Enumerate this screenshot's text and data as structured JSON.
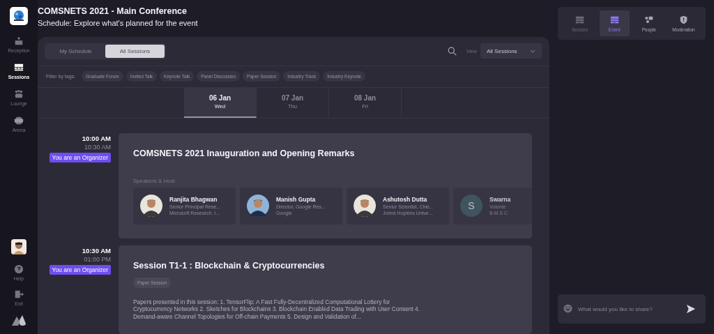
{
  "event": {
    "title": "COMSNETS 2021 - Main Conference",
    "subtitle": "Schedule: Explore what's planned for the event"
  },
  "sidebar": {
    "items": [
      {
        "label": "Reception",
        "selected": false
      },
      {
        "label": "Sessions",
        "selected": true
      },
      {
        "label": "Lounge",
        "selected": false
      },
      {
        "label": "Arena",
        "selected": false
      }
    ],
    "bottom_items": [
      "Help",
      "Exit"
    ]
  },
  "schedule_toggle": [
    {
      "label": "My Schedule",
      "selected": false
    },
    {
      "label": "All Sessions",
      "selected": true
    }
  ],
  "view": {
    "label": "View",
    "value": "All Sessions"
  },
  "filter": {
    "label": "Filter by tags:",
    "tags": [
      "Graduate Forum",
      "Invited Talk",
      "Keynote Talk",
      "Panel Discussion",
      "Paper Session",
      "Industry Track",
      "Industry Keynote"
    ]
  },
  "days": [
    {
      "date": "06 Jan",
      "weekday": "Wed",
      "selected": true
    },
    {
      "date": "07 Jan",
      "weekday": "Thu",
      "selected": false
    },
    {
      "date": "08 Jan",
      "weekday": "Fri",
      "selected": false
    }
  ],
  "sessions": [
    {
      "start": "10:00 AM",
      "end": "10:30 AM",
      "badge": "You are an Organizer",
      "title": "COMSNETS 2021 Inauguration and Opening Remarks",
      "speakers_label": "Speakers & Host",
      "speakers": [
        {
          "name": "Ranjita Bhagwan",
          "role": "Senior Principal Rese...",
          "org": "Microsoft Research. I..."
        },
        {
          "name": "Manish Gupta",
          "role": "Director, Google Res...",
          "org": "Google"
        },
        {
          "name": "Ashutosh Dutta",
          "role": "Senior Scientist, Chie...",
          "org": "Johns Hopkins Unive..."
        },
        {
          "name": "Swarna",
          "role": "Volunte",
          "org": "B.M.S C",
          "kind": "initial",
          "initial": "S"
        }
      ]
    },
    {
      "start": "10:30 AM",
      "end": "01:00 PM",
      "badge": "You are an Organizer",
      "title": "Session T1-1 : Blockchain & Cryptocurrencies",
      "tags": [
        "Paper Session"
      ],
      "description": "Papers presented in this session: 1. TensorFlip: A Fast Fully-Decentralized Computational Lottery for Cryptocurrency Networks 2. Sketches for Blockchains 3. Blockchain Enabled Data Trading with User Consent 4. Demand-aware Channel Topologies for Off-chain Payments 5. Design and Validation of..."
    }
  ],
  "panel_tabs": [
    {
      "label": "Session",
      "selected": false,
      "disabled": true
    },
    {
      "label": "Event",
      "selected": true,
      "disabled": false
    },
    {
      "label": "People",
      "selected": false,
      "disabled": false
    },
    {
      "label": "Moderation",
      "selected": false,
      "disabled": false
    }
  ],
  "chat": {
    "placeholder": "What would you like to share?"
  }
}
